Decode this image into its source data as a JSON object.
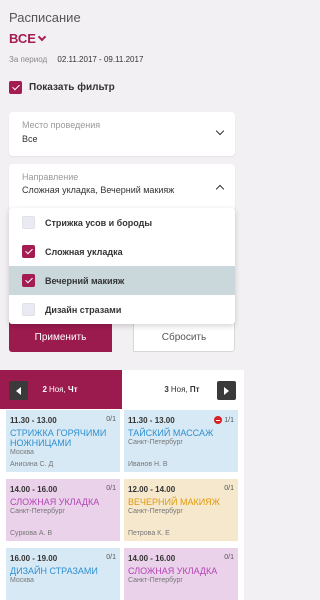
{
  "header": {
    "title": "Расписание",
    "filter_value": "ВСЕ",
    "period_label": "За период",
    "period_value": "02.11.2017 - 09.11.2017"
  },
  "show_filter": {
    "label": "Показать фильтр",
    "checked": true
  },
  "venue": {
    "label": "Место проведения",
    "value": "Все"
  },
  "direction": {
    "label": "Направление",
    "value": "Сложная укладка, Вечерний макияж",
    "options": [
      {
        "label": "Стрижка усов и бороды",
        "checked": false
      },
      {
        "label": "Сложная укладка",
        "checked": true
      },
      {
        "label": "Вечерний макияж",
        "checked": true
      },
      {
        "label": "Дизайн стразами",
        "checked": false
      }
    ]
  },
  "buttons": {
    "apply": "Применить",
    "reset": "Сбросить"
  },
  "days": [
    {
      "num": "2",
      "month": "Ноя,",
      "dow": "Чт",
      "active": true
    },
    {
      "num": "3",
      "month": "Ноя,",
      "dow": "Пт",
      "active": false
    }
  ],
  "events": [
    {
      "time": "11.30 - 13.00",
      "capacity": "0/1",
      "full": false,
      "name": "Стрижка горячими ножницами",
      "location": "Москва",
      "trainer": "Анисина С. Д",
      "color": "blue"
    },
    {
      "time": "11.30 - 13.00",
      "capacity": "1/1",
      "full": true,
      "name": "Тайский массаж",
      "location": "Санкт-Петербург",
      "trainer": "Иванов Н. В",
      "color": "blue"
    },
    {
      "time": "14.00 - 16.00",
      "capacity": "0/1",
      "full": false,
      "name": "Сложная укладка",
      "location": "Санкт-Петербург",
      "trainer": "Суркова А. В",
      "color": "pink"
    },
    {
      "time": "12.00 - 14.00",
      "capacity": "0/1",
      "full": false,
      "name": "Вечерний макияж",
      "location": "Санкт-Петербург",
      "trainer": "Петрова К. Е",
      "color": "yellow"
    },
    {
      "time": "16.00 - 19.00",
      "capacity": "0/1",
      "full": false,
      "name": "Дизайн стразами",
      "location": "Москва",
      "trainer": "",
      "color": "blue"
    },
    {
      "time": "14.00 - 16.00",
      "capacity": "0/1",
      "full": false,
      "name": "Сложная укладка",
      "location": "Санкт-Петербург",
      "trainer": "",
      "color": "pink"
    }
  ],
  "colors": {
    "accent": "#9c1b4e",
    "blue_text": "#2e8fd0",
    "pink_text": "#b444b4",
    "yellow_text": "#e19a0c",
    "full_badge": "#d42323"
  }
}
